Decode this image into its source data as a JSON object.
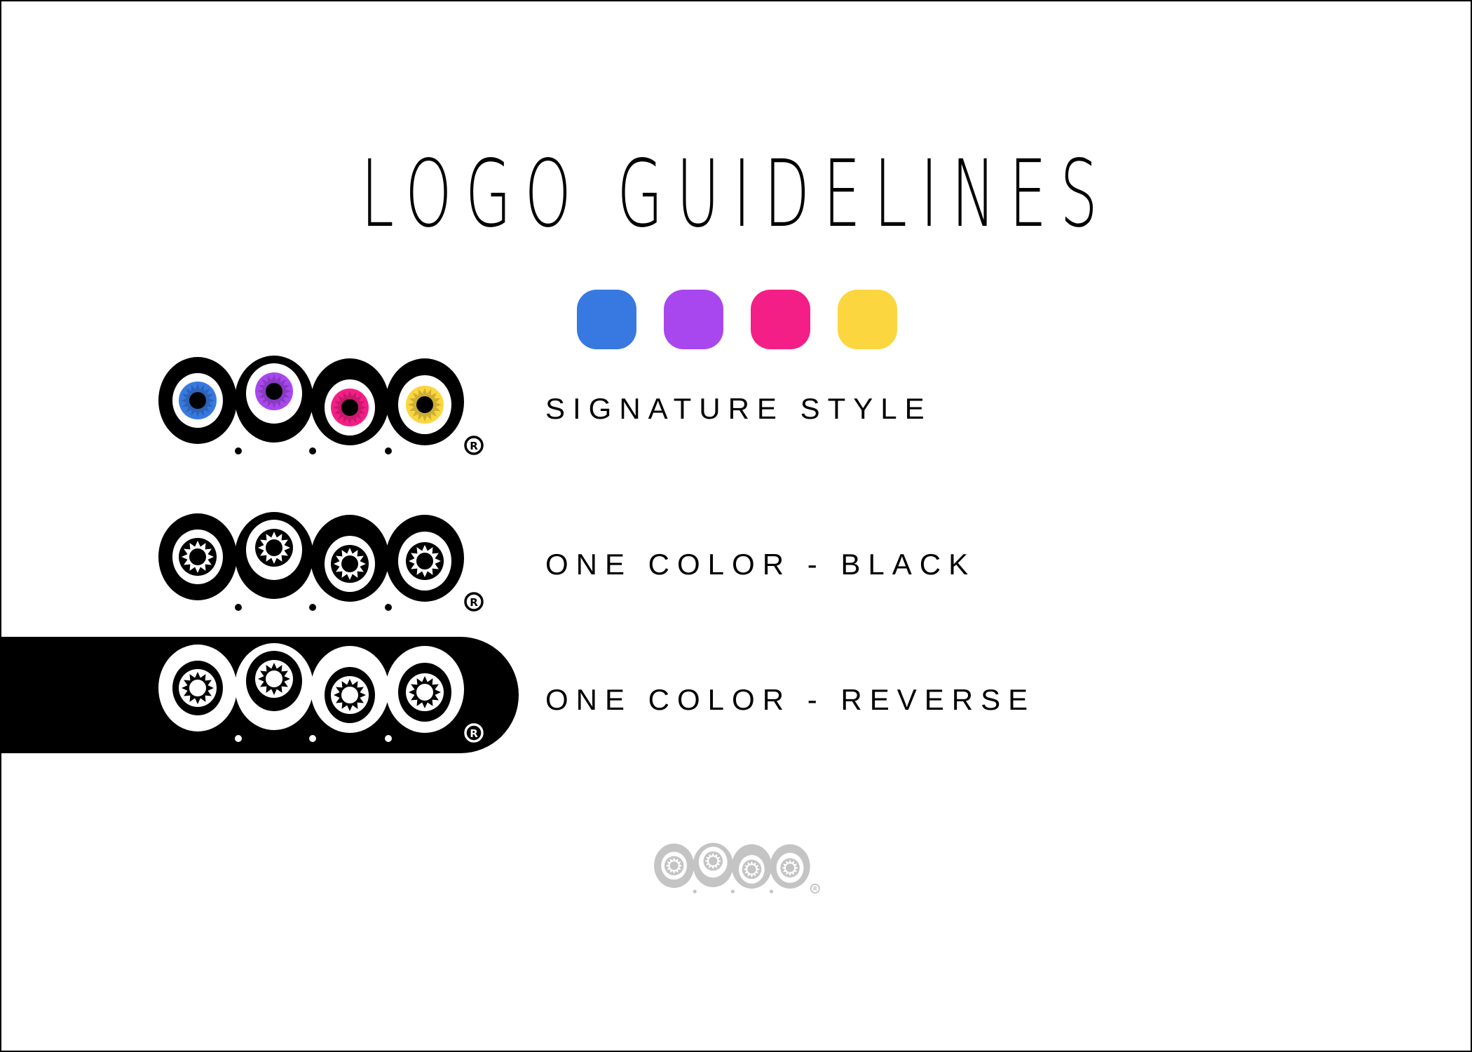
{
  "title": "LOGO GUIDELINES",
  "palette": [
    {
      "name": "blue",
      "color": "#3779E0"
    },
    {
      "name": "purple",
      "color": "#A847EE"
    },
    {
      "name": "pink",
      "color": "#F41F86"
    },
    {
      "name": "yellow",
      "color": "#FBD63F"
    }
  ],
  "rows": [
    {
      "id": "signature",
      "label": "SIGNATURE STYLE",
      "style": "color"
    },
    {
      "id": "black",
      "label": "ONE COLOR - BLACK",
      "style": "black"
    },
    {
      "id": "reverse",
      "label": "ONE COLOR - REVERSE",
      "style": "reverse"
    }
  ],
  "registered_mark": "®",
  "watermark": {
    "style": "gray",
    "color": "#C4C4C4"
  }
}
